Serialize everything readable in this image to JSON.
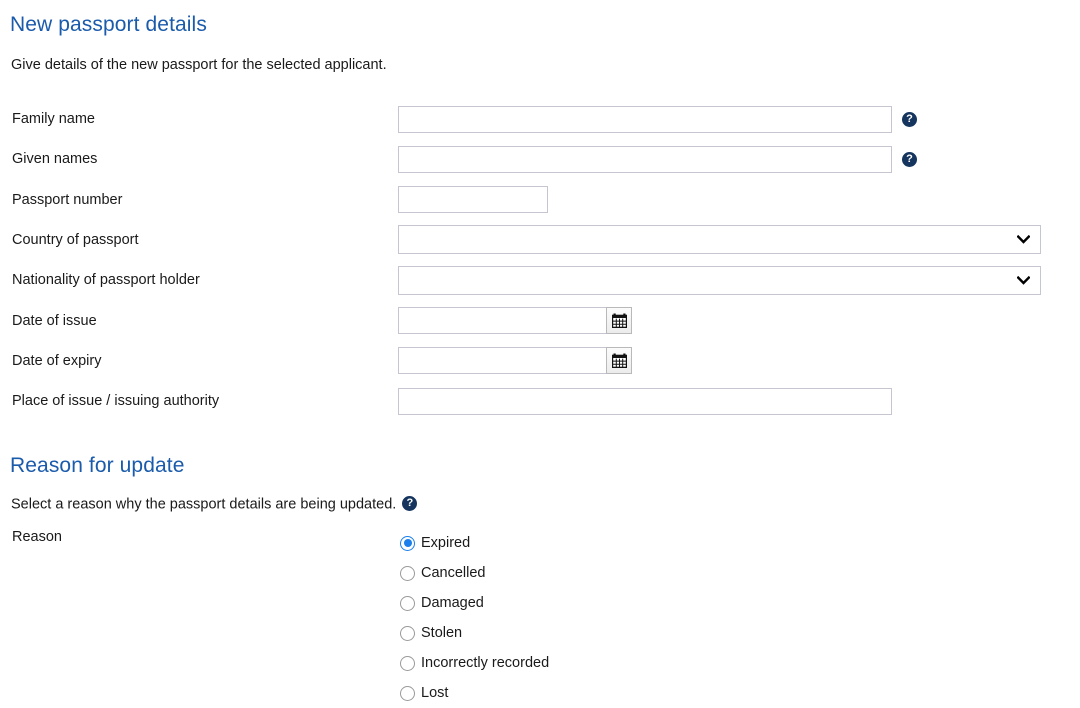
{
  "sections": {
    "passport": {
      "heading": "New passport details",
      "intro": "Give details of the new passport for the selected applicant."
    },
    "reason": {
      "heading": "Reason for update",
      "intro": "Select a reason why the passport details are being updated.",
      "help_icon": "help-icon",
      "field_label": "Reason"
    }
  },
  "fields": [
    {
      "label": "Family name",
      "type": "text",
      "value": "",
      "placeholder": "",
      "width": "wide",
      "help": true,
      "help_icon": "help-icon"
    },
    {
      "label": "Given names",
      "type": "text",
      "value": "",
      "placeholder": "",
      "width": "wide",
      "help": true,
      "help_icon": "help-icon"
    },
    {
      "label": "Passport number",
      "type": "text",
      "value": "",
      "placeholder": "",
      "width": "short",
      "help": false
    },
    {
      "label": "Country of passport",
      "type": "select",
      "value": "",
      "help": false,
      "chevron_icon": "chevron-down-icon"
    },
    {
      "label": "Nationality of passport holder",
      "type": "select",
      "value": "",
      "help": false,
      "chevron_icon": "chevron-down-icon"
    },
    {
      "label": "Date of issue",
      "type": "date",
      "value": "",
      "placeholder": "",
      "help": false,
      "button_icon": "calendar-icon"
    },
    {
      "label": "Date of expiry",
      "type": "date",
      "value": "",
      "placeholder": "",
      "help": false,
      "button_icon": "calendar-icon"
    },
    {
      "label": "Place of issue / issuing authority",
      "type": "text",
      "value": "",
      "placeholder": "",
      "width": "wide",
      "help": false
    }
  ],
  "reason_options": [
    {
      "label": "Expired",
      "checked": true
    },
    {
      "label": "Cancelled",
      "checked": false
    },
    {
      "label": "Damaged",
      "checked": false
    },
    {
      "label": "Stolen",
      "checked": false
    },
    {
      "label": "Incorrectly recorded",
      "checked": false
    },
    {
      "label": "Lost",
      "checked": false
    }
  ],
  "colors": {
    "heading": "#1a5bab",
    "text": "#1a1a1a",
    "input_border": "#c6c6d0",
    "help_badge": "#15355e",
    "radio_selected": "#1b7fec",
    "background": "#ffffff"
  }
}
